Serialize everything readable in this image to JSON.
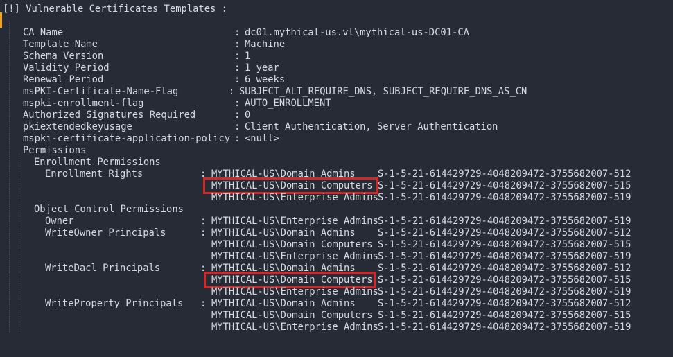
{
  "header": "[!] Vulnerable Certificates Templates :",
  "fields": [
    {
      "key": "CA Name",
      "value": "dc01.mythical-us.vl\\mythical-us-DC01-CA"
    },
    {
      "key": "Template Name",
      "value": "Machine"
    },
    {
      "key": "Schema Version",
      "value": "1"
    },
    {
      "key": "Validity Period",
      "value": "1 year"
    },
    {
      "key": "Renewal Period",
      "value": "6 weeks"
    },
    {
      "key": "msPKI-Certificate-Name-Flag",
      "value": "SUBJECT_ALT_REQUIRE_DNS, SUBJECT_REQUIRE_DNS_AS_CN"
    },
    {
      "key": "mspki-enrollment-flag",
      "value": "AUTO_ENROLLMENT"
    },
    {
      "key": "Authorized Signatures Required",
      "value": "0"
    },
    {
      "key": "pkiextendedkeyusage",
      "value": "Client Authentication, Server Authentication"
    },
    {
      "key": "mspki-certificate-application-policy",
      "value": "<null>"
    }
  ],
  "permissions_label": "Permissions",
  "enrollment_permissions_label": "Enrollment Permissions",
  "enrollment_rights": {
    "label": "Enrollment Rights",
    "entries": [
      {
        "principal": "MYTHICAL-US\\Domain Admins",
        "sid": "S-1-5-21-614429729-4048209472-3755682007-512"
      },
      {
        "principal": "MYTHICAL-US\\Domain Computers",
        "sid": "S-1-5-21-614429729-4048209472-3755682007-515"
      },
      {
        "principal": "MYTHICAL-US\\Enterprise Admins",
        "sid": "S-1-5-21-614429729-4048209472-3755682007-519"
      }
    ]
  },
  "object_control_label": "Object Control Permissions",
  "owner": {
    "label": "Owner",
    "principal": "MYTHICAL-US\\Enterprise Admins",
    "sid": "S-1-5-21-614429729-4048209472-3755682007-519"
  },
  "writeowner": {
    "label": "WriteOwner Principals",
    "entries": [
      {
        "principal": "MYTHICAL-US\\Domain Admins",
        "sid": "S-1-5-21-614429729-4048209472-3755682007-512"
      },
      {
        "principal": "MYTHICAL-US\\Domain Computers",
        "sid": "S-1-5-21-614429729-4048209472-3755682007-515"
      },
      {
        "principal": "MYTHICAL-US\\Enterprise Admins",
        "sid": "S-1-5-21-614429729-4048209472-3755682007-519"
      }
    ]
  },
  "writedacl": {
    "label": "WriteDacl Principals",
    "entries": [
      {
        "principal": "MYTHICAL-US\\Domain Admins",
        "sid": "S-1-5-21-614429729-4048209472-3755682007-512"
      },
      {
        "principal": "MYTHICAL-US\\Domain Computers",
        "sid": "S-1-5-21-614429729-4048209472-3755682007-515"
      },
      {
        "principal": "MYTHICAL-US\\Enterprise Admins",
        "sid": "S-1-5-21-614429729-4048209472-3755682007-519"
      }
    ]
  },
  "writeproperty": {
    "label": "WriteProperty Principals",
    "entries": [
      {
        "principal": "MYTHICAL-US\\Domain Admins",
        "sid": "S-1-5-21-614429729-4048209472-3755682007-512"
      },
      {
        "principal": "MYTHICAL-US\\Domain Computers",
        "sid": "S-1-5-21-614429729-4048209472-3755682007-515"
      },
      {
        "principal": "MYTHICAL-US\\Enterprise Admins",
        "sid": "S-1-5-21-614429729-4048209472-3755682007-519"
      }
    ]
  },
  "separator": ":",
  "colors": {
    "background": "#272b36",
    "text": "#d6d9e0",
    "cursor": "#f2a31b",
    "highlight_box": "#d42828"
  }
}
